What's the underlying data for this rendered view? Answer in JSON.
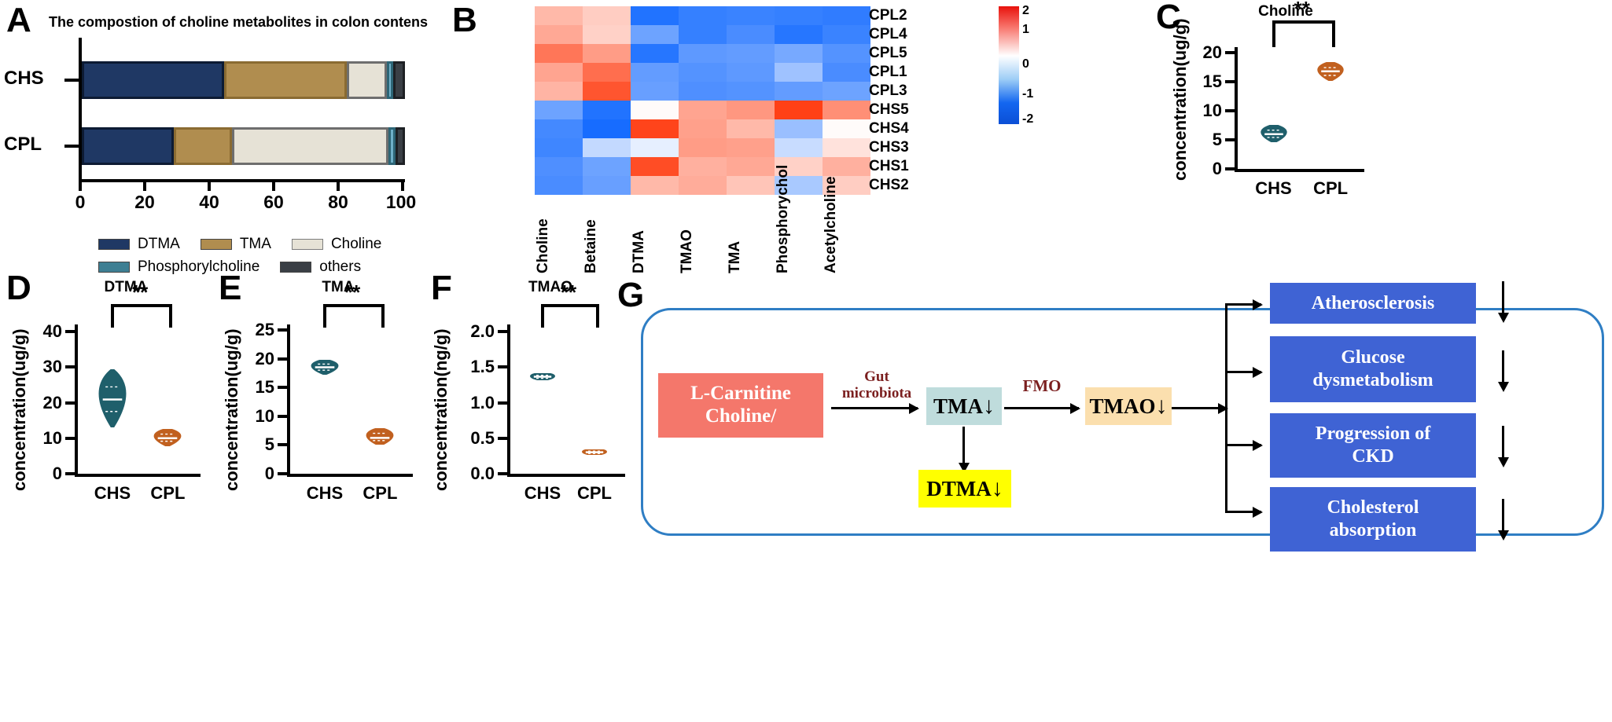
{
  "panels": {
    "A": {
      "label": "A",
      "title": "The compostion of choline metabolites in colon contens",
      "rows": [
        "CHS",
        "CPL"
      ],
      "xticks": [
        "0",
        "20",
        "40",
        "60",
        "80",
        "100"
      ],
      "legend": [
        {
          "name": "DTMA",
          "color": "#1f3864"
        },
        {
          "name": "TMA",
          "color": "#b08d4f"
        },
        {
          "name": "Choline",
          "color": "#e6e2d6"
        },
        {
          "name": "Phosphorylcholine",
          "color": "#3e7f93"
        },
        {
          "name": "others",
          "color": "#3a3f45"
        }
      ]
    },
    "B": {
      "label": "B",
      "row_labels": [
        "CPL2",
        "CPL4",
        "CPL5",
        "CPL1",
        "CPL3",
        "CHS5",
        "CHS4",
        "CHS3",
        "CHS1",
        "CHS2"
      ],
      "col_labels": [
        "Choline",
        "Betaine",
        "DTMA",
        "TMAO",
        "TMA",
        "Phosphorychol",
        "Acetylcholine"
      ],
      "colorbar_ticks": [
        "2",
        "1",
        "0",
        "-1",
        "-2"
      ]
    },
    "C": {
      "label": "C",
      "title": "Choline",
      "ylabel": "concentration(ug/g)",
      "yticks": [
        "20",
        "15",
        "10",
        "5",
        "0"
      ],
      "xlabels": [
        "CHS",
        "CPL"
      ],
      "significance": "**"
    },
    "D": {
      "label": "D",
      "title": "DTMA",
      "ylabel": "concentration(ug/g)",
      "yticks": [
        "40",
        "30",
        "20",
        "10",
        "0"
      ],
      "xlabels": [
        "CHS",
        "CPL"
      ],
      "significance": "**"
    },
    "E": {
      "label": "E",
      "title": "TMA",
      "ylabel": "concentration(ug/g)",
      "yticks": [
        "25",
        "20",
        "15",
        "10",
        "5",
        "0"
      ],
      "xlabels": [
        "CHS",
        "CPL"
      ],
      "significance": "**"
    },
    "F": {
      "label": "F",
      "title": "TMAO",
      "ylabel": "concentration(ng/g)",
      "yticks": [
        "2.0",
        "1.5",
        "1.0",
        "0.5",
        "0.0"
      ],
      "xlabels": [
        "CHS",
        "CPL"
      ],
      "significance": "**"
    },
    "G": {
      "label": "G",
      "nodes": {
        "source": "L-Carnitine\nCholine/",
        "tma": "TMA",
        "tmao": "TMAO",
        "dtma": "DTMA",
        "out1": "Atherosclerosis",
        "out2": "Glucose\ndysmetabolism",
        "out3": "Progression of\nCKD",
        "out4": "Cholesterol\nabsorption"
      },
      "edge_labels": {
        "gut": "Gut\nmicrobiota",
        "fmo": "FMO"
      },
      "down_arrow": "↓",
      "colors": {
        "source": "#f4776b",
        "tma": "#bfdcdc",
        "tmao": "#fbdfae",
        "dtma": "#ffff00",
        "outcome": "#3f63d4",
        "border": "#2f7ec4",
        "edge_text": "#7b1f1f"
      }
    }
  },
  "chart_data": [
    {
      "type": "bar",
      "title": "The compostion of choline metabolites in colon contens",
      "orientation": "horizontal",
      "stacked": true,
      "categories": [
        "CHS",
        "CPL"
      ],
      "xlabel": "",
      "ylabel": "",
      "xlim": [
        0,
        100
      ],
      "xticks": [
        0,
        20,
        40,
        60,
        80,
        100
      ],
      "grid": false,
      "legend_position": "bottom",
      "series": [
        {
          "name": "DTMA",
          "color": "#1f3864",
          "values": [
            44.0,
            28.5
          ]
        },
        {
          "name": "TMA",
          "color": "#b08d4f",
          "values": [
            38.0,
            18.0
          ]
        },
        {
          "name": "Choline",
          "color": "#e6e2d6",
          "values": [
            12.5,
            48.5
          ]
        },
        {
          "name": "Phosphorylcholine",
          "color": "#6fb0c8",
          "values": [
            1.8,
            2.2
          ]
        },
        {
          "name": "others",
          "color": "#3a3f45",
          "values": [
            3.7,
            2.8
          ]
        }
      ]
    },
    {
      "type": "heatmap",
      "title": "",
      "row_labels": [
        "CPL2",
        "CPL4",
        "CPL5",
        "CPL1",
        "CPL3",
        "CHS5",
        "CHS4",
        "CHS3",
        "CHS1",
        "CHS2"
      ],
      "col_labels": [
        "Choline",
        "Betaine",
        "DTMA",
        "TMAO",
        "TMA",
        "Phosphorychol",
        "Acetylcholine"
      ],
      "zlim": [
        -2.4,
        2.4
      ],
      "colorbar_ticks": [
        2,
        1,
        0,
        -1,
        -2
      ],
      "colormap": "blue-white-red",
      "values": [
        [
          0.85,
          0.6,
          -2.2,
          -2.0,
          -1.95,
          -2.0,
          -2.05
        ],
        [
          1.05,
          0.55,
          -1.45,
          -2.0,
          -1.8,
          -2.15,
          -1.95
        ],
        [
          1.65,
          1.2,
          -2.15,
          -1.6,
          -1.55,
          -1.35,
          -1.7
        ],
        [
          1.1,
          1.75,
          -1.55,
          -1.7,
          -1.6,
          -0.95,
          -1.8
        ],
        [
          0.9,
          2.05,
          -1.5,
          -1.75,
          -1.7,
          -1.55,
          -1.45
        ],
        [
          -1.45,
          -2.2,
          0.05,
          1.1,
          1.25,
          2.3,
          1.35
        ],
        [
          -1.85,
          -2.3,
          2.25,
          1.15,
          0.85,
          -1.0,
          0.05
        ],
        [
          -1.9,
          -0.6,
          -0.25,
          1.2,
          1.15,
          -0.55,
          0.35
        ],
        [
          -1.75,
          -1.45,
          2.15,
          0.95,
          1.05,
          0.55,
          0.95
        ],
        [
          -1.8,
          -1.5,
          0.85,
          1.0,
          0.7,
          -0.85,
          0.6
        ]
      ]
    },
    {
      "type": "violin",
      "title": "Choline",
      "ylabel": "concentration(ug/g)",
      "categories": [
        "CHS",
        "CPL"
      ],
      "ylim": [
        0,
        21
      ],
      "yticks": [
        0,
        5,
        10,
        15,
        20
      ],
      "groups": [
        {
          "name": "CHS",
          "color": "#1f5f6b",
          "median": 6.0,
          "min": 4.6,
          "max": 7.6
        },
        {
          "name": "CPL",
          "color": "#c1601f",
          "median": 16.8,
          "min": 15.2,
          "max": 18.4
        }
      ],
      "annotation": "**"
    },
    {
      "type": "violin",
      "title": "DTMA",
      "ylabel": "concentration(ug/g)",
      "categories": [
        "CHS",
        "CPL"
      ],
      "ylim": [
        0,
        42
      ],
      "yticks": [
        0,
        10,
        20,
        30,
        40
      ],
      "groups": [
        {
          "name": "CHS",
          "color": "#1f5f6b",
          "median": 21.0,
          "min": 13.0,
          "max": 29.5
        },
        {
          "name": "CPL",
          "color": "#c1601f",
          "median": 10.0,
          "min": 7.8,
          "max": 12.6
        }
      ],
      "annotation": "**"
    },
    {
      "type": "violin",
      "title": "TMA",
      "ylabel": "concentration(ug/g)",
      "categories": [
        "CHS",
        "CPL"
      ],
      "ylim": [
        0,
        26
      ],
      "yticks": [
        0,
        5,
        10,
        15,
        20,
        25
      ],
      "groups": [
        {
          "name": "CHS",
          "color": "#1f5f6b",
          "median": 18.5,
          "min": 17.3,
          "max": 19.8
        },
        {
          "name": "CPL",
          "color": "#c1601f",
          "median": 6.3,
          "min": 5.0,
          "max": 8.0
        }
      ],
      "annotation": "**"
    },
    {
      "type": "violin",
      "title": "TMAO",
      "ylabel": "concentration(ng/g)",
      "categories": [
        "CHS",
        "CPL"
      ],
      "ylim": [
        0,
        2.1
      ],
      "yticks": [
        0.0,
        0.5,
        1.0,
        1.5,
        2.0
      ],
      "groups": [
        {
          "name": "CHS",
          "color": "#1f5f6b",
          "median": 1.37,
          "min": 1.32,
          "max": 1.42
        },
        {
          "name": "CPL",
          "color": "#c1601f",
          "median": 0.3,
          "min": 0.26,
          "max": 0.34
        }
      ],
      "annotation": "**"
    }
  ]
}
